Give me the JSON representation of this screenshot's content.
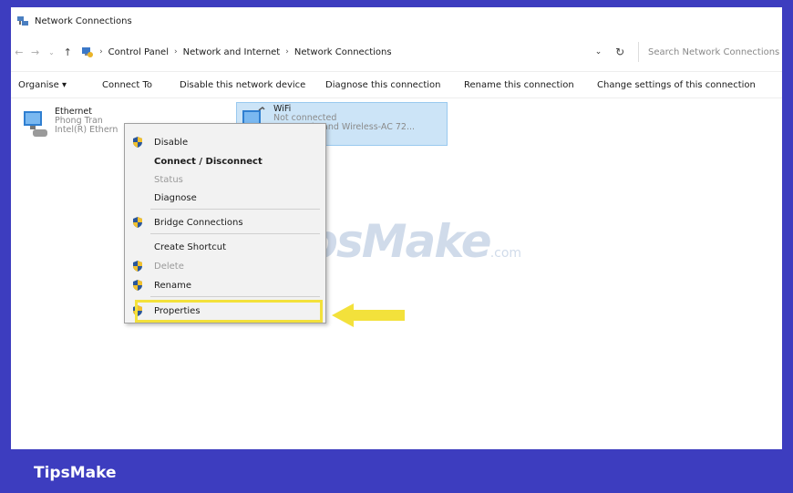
{
  "window": {
    "title": "Network Connections"
  },
  "address": {
    "breadcrumbs": [
      "Control Panel",
      "Network and Internet",
      "Network Connections"
    ],
    "search_placeholder": "Search Network Connections"
  },
  "toolbar": {
    "organise": "Organise ▾",
    "connect_to": "Connect To",
    "disable": "Disable this network device",
    "diagnose": "Diagnose this connection",
    "rename": "Rename this connection",
    "change": "Change settings of this connection"
  },
  "connections": [
    {
      "name": "Ethernet",
      "line2": "Phong Tran",
      "line3": "Intel(R) Ethern"
    },
    {
      "name": "WiFi",
      "line2": "Not connected",
      "line3": "ual Band Wireless-AC 72..."
    }
  ],
  "context_menu": {
    "items": [
      {
        "label": "Disable",
        "icon": "shield-icon"
      },
      {
        "label": "Connect / Disconnect"
      },
      {
        "label": "Status"
      },
      {
        "label": "Diagnose"
      },
      {
        "label": "Bridge Connections",
        "icon": "shield-icon"
      },
      {
        "label": "Create Shortcut"
      },
      {
        "label": "Delete",
        "icon": "shield-icon"
      },
      {
        "label": "Rename",
        "icon": "shield-icon"
      },
      {
        "label": "Properties",
        "icon": "shield-icon"
      }
    ]
  },
  "watermark": {
    "text": "TipsMake",
    "suffix": ".com"
  },
  "brand": {
    "name": "TipsMake"
  },
  "colors": {
    "frame": "#3d3dbf",
    "selection": "#cce4f7",
    "highlight": "#f3e13b"
  }
}
